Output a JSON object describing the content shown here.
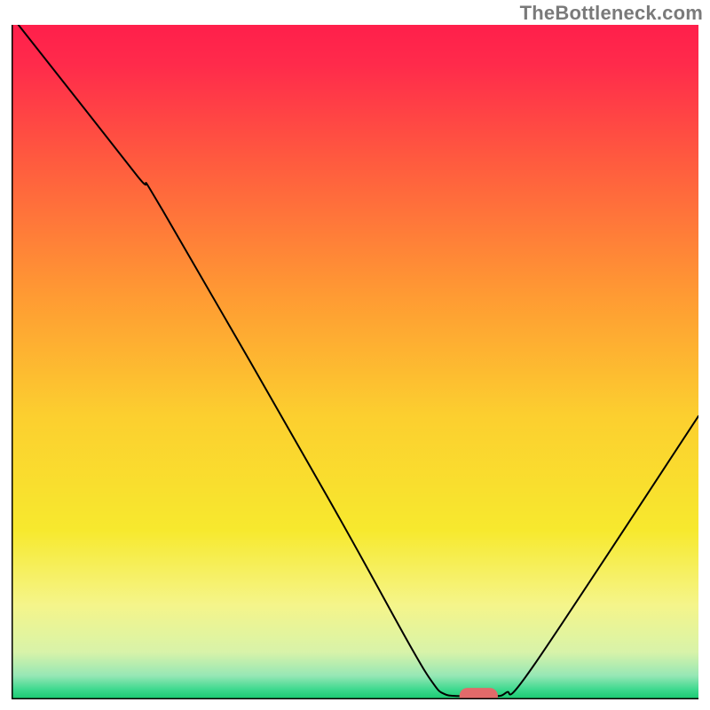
{
  "watermark": "TheBottleneck.com",
  "chart_data": {
    "type": "line",
    "title": "",
    "xlabel": "",
    "ylabel": "",
    "xlim": [
      0,
      100
    ],
    "ylim": [
      0,
      100
    ],
    "grid": false,
    "x_ticks": [],
    "y_ticks": [],
    "background": {
      "type": "vertical-gradient",
      "stops": [
        {
          "pos": 0.0,
          "color": "#ff1f4b"
        },
        {
          "pos": 0.06,
          "color": "#ff2b4b"
        },
        {
          "pos": 0.2,
          "color": "#ff5a3f"
        },
        {
          "pos": 0.4,
          "color": "#ff9a33"
        },
        {
          "pos": 0.58,
          "color": "#fccf2f"
        },
        {
          "pos": 0.75,
          "color": "#f7e92e"
        },
        {
          "pos": 0.86,
          "color": "#f5f58a"
        },
        {
          "pos": 0.93,
          "color": "#d8f3a9"
        },
        {
          "pos": 0.965,
          "color": "#96e7b5"
        },
        {
          "pos": 0.985,
          "color": "#3fd98f"
        },
        {
          "pos": 1.0,
          "color": "#17c96f"
        }
      ]
    },
    "series": [
      {
        "name": "bottleneck-curve",
        "color": "#000000",
        "width": 2,
        "points": [
          {
            "x": 1.0,
            "y": 100.0
          },
          {
            "x": 18.0,
            "y": 78.0
          },
          {
            "x": 22.0,
            "y": 72.5
          },
          {
            "x": 46.0,
            "y": 30.0
          },
          {
            "x": 58.0,
            "y": 8.0
          },
          {
            "x": 61.5,
            "y": 2.2
          },
          {
            "x": 63.0,
            "y": 0.8
          },
          {
            "x": 65.0,
            "y": 0.5
          },
          {
            "x": 70.0,
            "y": 0.5
          },
          {
            "x": 72.0,
            "y": 1.0
          },
          {
            "x": 76.0,
            "y": 5.0
          },
          {
            "x": 100.0,
            "y": 42.0
          }
        ]
      }
    ],
    "marker": {
      "x": 68.0,
      "y": 0.5,
      "rx": 2.8,
      "ry": 1.2,
      "color": "#e26a6a"
    },
    "frame_color": "#000000"
  }
}
